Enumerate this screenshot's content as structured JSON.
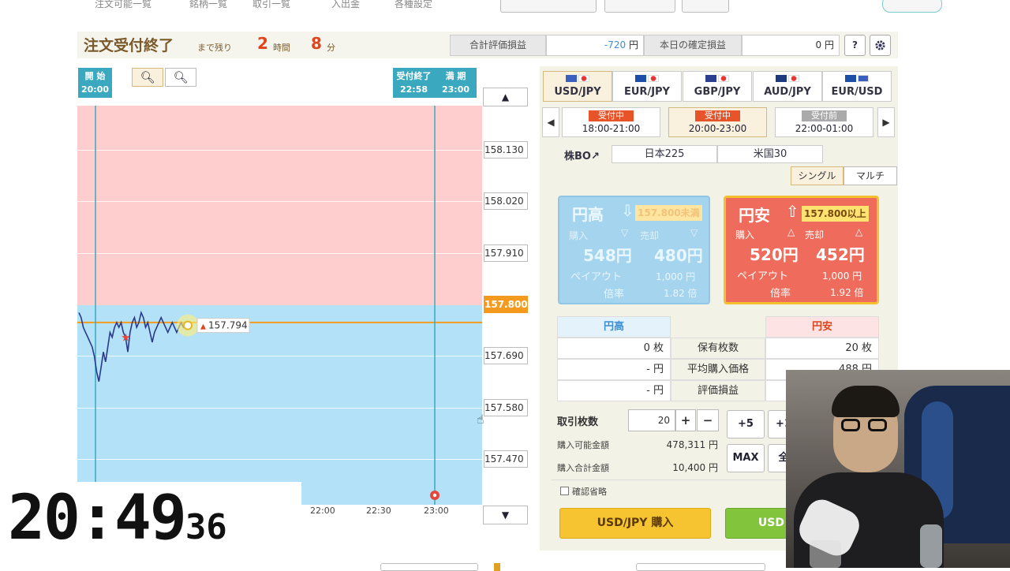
{
  "nav": {
    "items": [
      "注文可能一覧",
      "銘柄一覧",
      "取引一覧",
      "入出金",
      "各種設定"
    ]
  },
  "status": {
    "title": "注文受付終了",
    "remaining_label": "まで残り",
    "hours": "2",
    "hours_unit": "時間",
    "minutes": "8",
    "minutes_unit": "分",
    "eval_label": "合計評価損益",
    "eval_value": "-720",
    "eval_unit": "円",
    "confirmed_label": "本日の確定損益",
    "confirmed_value": "0",
    "confirmed_unit": "円",
    "help": "?"
  },
  "chart": {
    "start_label": "開 始",
    "start_time": "20:00",
    "close_label": "受付終了",
    "close_time": "22:58",
    "expiry_label": "満 期",
    "expiry_time": "23:00",
    "up_arrow": "▲",
    "down_arrow": "▼",
    "current_badge": "157.794",
    "times": [
      "22:00",
      "22:30",
      "23:00"
    ]
  },
  "chart_data": {
    "type": "line",
    "price_levels": [
      "158.130",
      "158.020",
      "157.910",
      "157.800",
      "157.690",
      "157.580",
      "157.470"
    ],
    "target": "157.800",
    "ylim": [
      157.43,
      158.24
    ],
    "series": [
      {
        "x": [
          0,
          1,
          2,
          3,
          4,
          5,
          6,
          7,
          8,
          9,
          10,
          11,
          12,
          13,
          14,
          15,
          16,
          17,
          18,
          19,
          20,
          21,
          22,
          23,
          24,
          25,
          26,
          27,
          28,
          29,
          30,
          31,
          32,
          33,
          34,
          35,
          36,
          37,
          38,
          39,
          40,
          41,
          42,
          43,
          44,
          45,
          46,
          47,
          48,
          49
        ],
        "values": [
          157.82,
          157.81,
          157.79,
          157.78,
          157.77,
          157.76,
          157.75,
          157.73,
          157.7,
          157.68,
          157.71,
          157.74,
          157.72,
          157.75,
          157.78,
          157.77,
          157.79,
          157.8,
          157.79,
          157.8,
          157.78,
          157.77,
          157.74,
          157.78,
          157.8,
          157.81,
          157.79,
          157.8,
          157.82,
          157.81,
          157.79,
          157.8,
          157.78,
          157.76,
          157.78,
          157.79,
          157.8,
          157.81,
          157.8,
          157.79,
          157.78,
          157.79,
          157.8,
          157.79,
          157.78,
          157.79,
          157.8,
          157.79,
          157.794,
          157.794
        ]
      }
    ]
  },
  "pairs": [
    {
      "name": "USD/JPY",
      "c1": "#3a5fbf",
      "c2": "#e33"
    },
    {
      "name": "EUR/JPY",
      "c1": "#1d4fa8",
      "c2": "#e33"
    },
    {
      "name": "GBP/JPY",
      "c1": "#2a3f8f",
      "c2": "#e33"
    },
    {
      "name": "AUD/JPY",
      "c1": "#1e3a7f",
      "c2": "#e33"
    },
    {
      "name": "EUR/USD",
      "c1": "#1d4fa8",
      "c2": "#3a5fbf"
    }
  ],
  "slots": [
    {
      "badge": "受付中",
      "time": "18:00-21:00",
      "color": "#e8542a"
    },
    {
      "badge": "受付中",
      "time": "20:00-23:00",
      "color": "#e8542a"
    },
    {
      "badge": "受付前",
      "time": "22:00-01:00",
      "color": "#aaaaaa"
    }
  ],
  "stock": {
    "label": "株BO↗",
    "tab1": "日本225",
    "tab2": "米国30"
  },
  "modes": {
    "single": "シングル",
    "multi": "マルチ"
  },
  "high": {
    "title": "円高",
    "condition": "157.800未満",
    "buy_label": "購入",
    "buy_price": "548円",
    "sell_label": "売却",
    "sell_price": "480円",
    "payout_label": "ペイアウト",
    "payout": "1,000 円",
    "rate_label": "倍率",
    "rate": "1.82 倍"
  },
  "low": {
    "title": "円安",
    "condition": "157.800以上",
    "buy_label": "購入",
    "buy_price": "520円",
    "sell_label": "売却",
    "sell_price": "452円",
    "payout_label": "ペイアウト",
    "payout": "1,000 円",
    "rate_label": "倍率",
    "rate": "1.92 倍"
  },
  "holdings": {
    "col_high": "円高",
    "col_low": "円安",
    "row1_label": "保有枚数",
    "row1_high": "0 枚",
    "row1_low": "20 枚",
    "row2_label": "平均購入価格",
    "row2_high": "- 円",
    "row2_low": "488 円",
    "row3_label": "評価損益",
    "row3_high": "- 円"
  },
  "order": {
    "qty_label": "取引枚数",
    "qty": "20",
    "plus": "+",
    "minus": "−",
    "plus5": "+5",
    "plus10": "+1",
    "max": "MAX",
    "all": "全",
    "avail_label": "購入可能金額",
    "avail": "478,311 円",
    "total_label": "購入合計金額",
    "total": "10,400 円",
    "skip_confirm": "確認省略",
    "buy_high": "USD/JPY 購入",
    "buy_low": "USD"
  },
  "clock": {
    "hm": "20:49",
    "sec": "36"
  }
}
